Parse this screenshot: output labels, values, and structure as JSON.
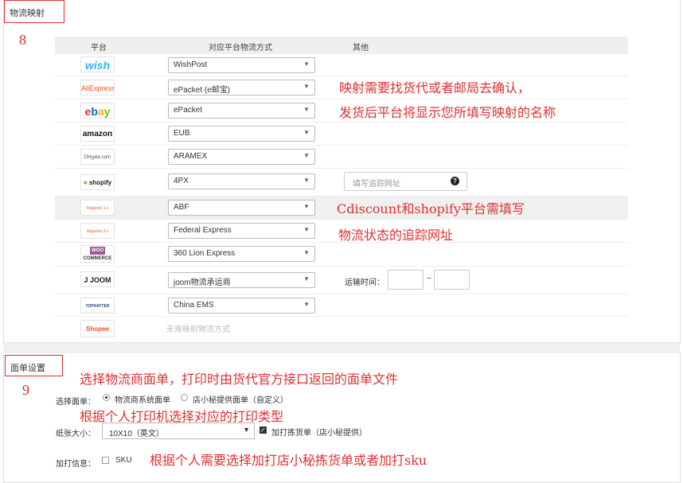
{
  "mapping": {
    "title": "物流映射",
    "step": "8",
    "headers": {
      "platform": "平台",
      "method": "对应平台物流方式",
      "other": "其他"
    },
    "rows": [
      {
        "platform": "wish",
        "logo_text": "wish",
        "value": "WishPost"
      },
      {
        "platform": "aliexpress",
        "logo_text": "AliExpress",
        "value": "ePacket (e邮宝)"
      },
      {
        "platform": "ebay",
        "logo_text": "ebay",
        "value": "ePacket"
      },
      {
        "platform": "amazon",
        "logo_text": "amazon",
        "value": "EUB"
      },
      {
        "platform": "dhgate",
        "logo_text": "DHgate.com",
        "value": "ARAMEX"
      },
      {
        "platform": "shopify",
        "logo_text": "shopify",
        "value": "4PX",
        "tracking_placeholder": "填写追踪网址"
      },
      {
        "platform": "magento1",
        "logo_text": "Magento 1.x",
        "value": "ABF"
      },
      {
        "platform": "magento2",
        "logo_text": "Magento 2.x",
        "value": "Federal Express"
      },
      {
        "platform": "woocommerce",
        "logo_text": "WOO COMMERCE",
        "value": "360 Lion Express"
      },
      {
        "platform": "joom",
        "logo_text": "JOOM",
        "value": "joom物流承运商",
        "transit_label": "运输时间：",
        "tilde": "~"
      },
      {
        "platform": "tophatter",
        "logo_text": "TOPHATTER",
        "value": "China EMS"
      },
      {
        "platform": "shopee",
        "logo_text": "Shopee",
        "no_mapping": "无需映射物流方式"
      }
    ],
    "annotations": {
      "a1": "映射需要找货代或者邮局去确认，",
      "a2": "发货后平台将显示您所填写映射的名称",
      "a3": "Cdiscount和shopify平台需填写",
      "a4": "物流状态的追踪网址"
    }
  },
  "waybill": {
    "title": "面单设置",
    "step": "9",
    "select_label": "选择面单：",
    "option1": "物流商系统面单",
    "option2": "店小秘提供面单（自定义）",
    "paper_label": "纸张大小：",
    "paper_value": "10X10（英文）",
    "picklist_label": "加打拣货单（店小秘提供）",
    "extra_label": "加打信息：",
    "sku_label": "SKU",
    "annotations": {
      "a1": "选择物流商面单，打印时由货代官方接口返回的面单文件",
      "a2": "根据个人打印机选择对应的打印类型",
      "a3": "根据个人需要选择加打店小秘拣货单或者加打sku"
    }
  },
  "colors": {
    "accent_red": "#e03030",
    "wish": "#2fb7ec",
    "aliexpress": "#e8541c",
    "amazon": "#111111",
    "shopee": "#ee4d2d",
    "woo": "#9b5c8f"
  }
}
